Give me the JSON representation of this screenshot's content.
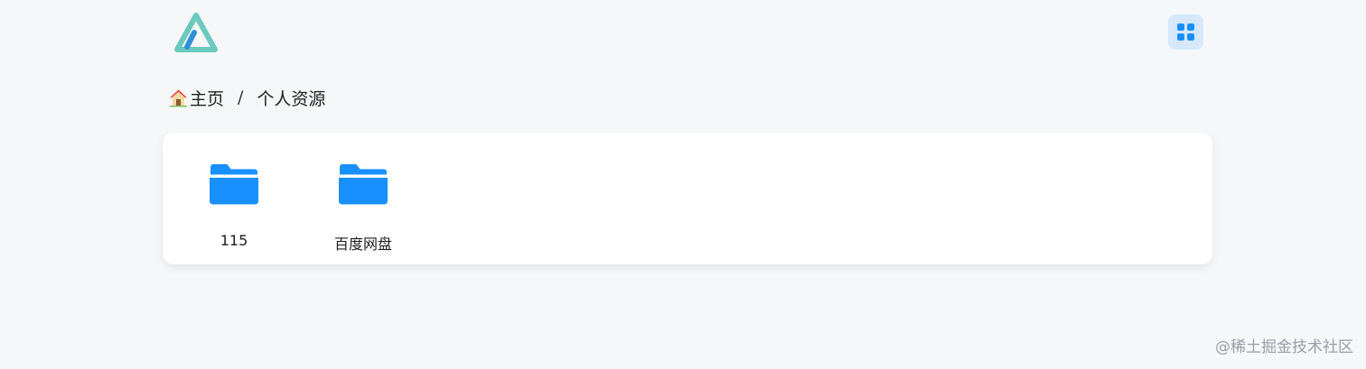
{
  "header": {
    "logo_icon": "triangle-logo-icon",
    "layout_toggle_icon": "grid-icon",
    "accent_color": "#1890ff",
    "logo_color": "#6cc9bd"
  },
  "breadcrumb": {
    "home_icon": "house-icon",
    "items": [
      "主页",
      "个人资源"
    ],
    "separator": "/"
  },
  "folders": [
    {
      "name": "115",
      "icon": "folder-icon"
    },
    {
      "name": "百度网盘",
      "icon": "folder-icon"
    }
  ],
  "watermark": "@稀土掘金技术社区"
}
